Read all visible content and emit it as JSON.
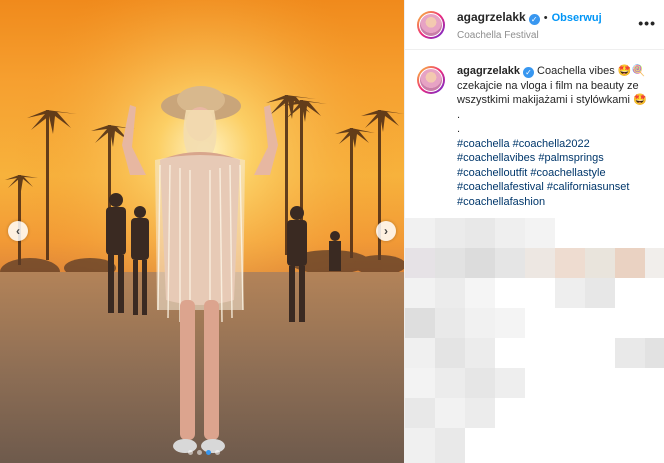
{
  "post": {
    "username": "agagrzelakk",
    "follow_label": "Obserwuj",
    "separator": "•",
    "location": "Coachella Festival",
    "more_label": "•••"
  },
  "caption": {
    "username": "agagrzelakk",
    "line1": "Coachella vibes 🤩🍭",
    "line2": "czekajcie na vloga i film na beauty ze",
    "line3": "wszystkimi makijażami i stylówkami 🤩",
    "dot1": ".",
    "dot2": ".",
    "hashtags": [
      "#coachella",
      "#coachella2022",
      "#coachellavibes",
      "#palmsprings",
      "#coachelloutfit",
      "#coachellastyle",
      "#coachellafestival",
      "#californiasunset",
      "#coachellafashion"
    ]
  },
  "carousel": {
    "prev_label": "‹",
    "next_label": "›",
    "dots": 4,
    "active_dot": 2
  },
  "colors": {
    "accent": "#0095f6",
    "verified": "#3897f0",
    "hashtag": "#00376b"
  }
}
